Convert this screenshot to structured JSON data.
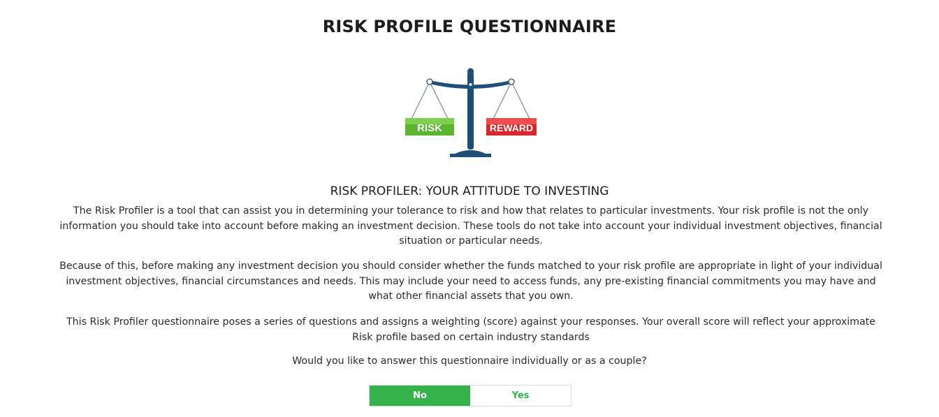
{
  "header": {
    "title": "RISK PROFILE QUESTIONNAIRE"
  },
  "illustration": {
    "icon": "balance-scale-icon",
    "left_label": "RISK",
    "right_label": "REWARD",
    "colors": {
      "beam": "#1f4e79",
      "risk": "#5cb531",
      "reward": "#d9262c"
    }
  },
  "intro": {
    "heading": "RISK PROFILER: YOUR ATTITUDE TO INVESTING",
    "paragraphs": [
      "The Risk Profiler is a tool that can assist you in determining your tolerance to risk and how that relates to particular investments. Your risk profile is not the only information you should take into account before making an investment decision. These tools do not take into account your individual investment objectives, financial situation or particular needs.",
      "Because of this, before making any investment decision you should consider whether the funds matched to your risk profile are appropriate in light of your individual investment objectives, financial circumstances and needs. This may include your need to access funds, any pre-existing financial commitments you may have and what other financial assets that you own.",
      "This Risk Profiler questionnaire poses a series of questions and assigns a weighting (score) against your responses. Your overall score will reflect your approximate Risk profile based on certain industry standards"
    ]
  },
  "question": {
    "text": "Would you like to answer this questionnaire individually or as a couple?",
    "options": [
      "No",
      "Yes"
    ],
    "selected": "No",
    "accent_color": "#35b34a"
  }
}
